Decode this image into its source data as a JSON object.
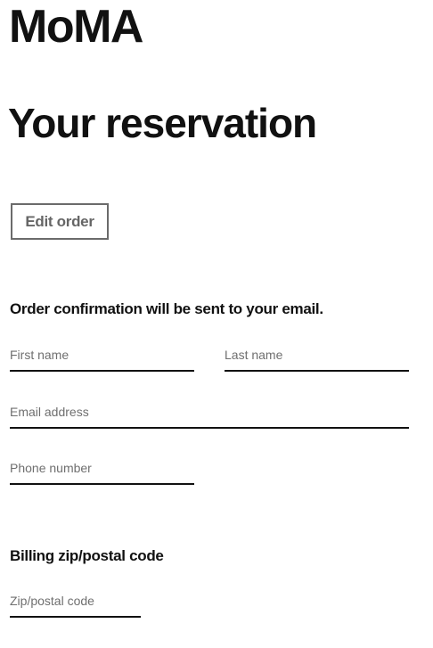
{
  "brand": {
    "logo_text": "MoMA"
  },
  "page": {
    "title": "Your reservation"
  },
  "actions": {
    "edit_order_label": "Edit order"
  },
  "contact_section": {
    "heading": "Order confirmation will be sent to your email.",
    "first_name": {
      "value": "",
      "placeholder": "First name"
    },
    "last_name": {
      "value": "",
      "placeholder": "Last name"
    },
    "email": {
      "value": "",
      "placeholder": "Email address"
    },
    "phone": {
      "value": "",
      "placeholder": "Phone number"
    }
  },
  "billing_section": {
    "heading": "Billing zip/postal code",
    "zip": {
      "value": "",
      "placeholder": "Zip/postal code"
    }
  },
  "colors": {
    "text": "#111111",
    "placeholder": "#6f6f6f",
    "button_border": "#6b6b6b",
    "button_text": "#666666",
    "background": "#ffffff"
  }
}
